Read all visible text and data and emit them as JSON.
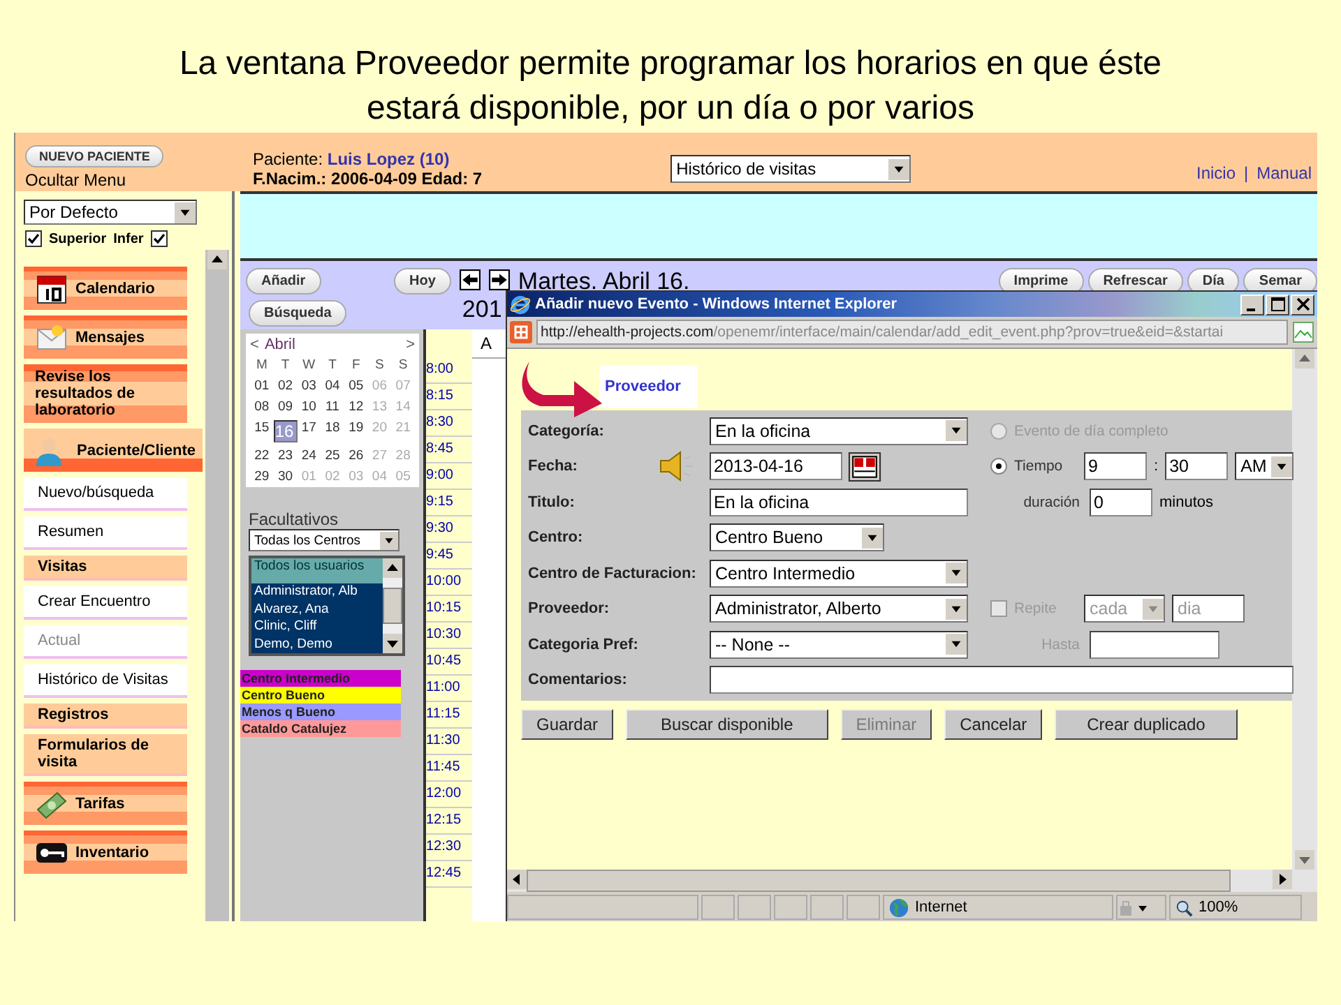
{
  "slide_title": "La ventana Proveedor permite programar los horarios en que éste estará disponible, por un día o por varios",
  "header": {
    "new_patient_button": "NUEVO PACIENTE",
    "hide_menu": "Ocultar Menu",
    "patient_label": "Paciente:",
    "patient_name": "Luis Lopez (10)",
    "birth": "F.Nacim.: 2006-04-09 Edad: 7",
    "view_select": "Histórico de visitas",
    "links": [
      "Inicio",
      "Manual"
    ],
    "link_separator": "|"
  },
  "sidebar": {
    "profile_select": "Por Defecto",
    "checks": [
      {
        "label": "Superior",
        "checked": true
      },
      {
        "label": "Infer",
        "checked": true
      }
    ],
    "items": [
      {
        "kind": "main",
        "label": "Calendario",
        "disabled": false
      },
      {
        "kind": "main",
        "label": "Mensajes",
        "disabled": false
      },
      {
        "kind": "main",
        "label": "Revise los resultados de laboratorio",
        "disabled": false
      },
      {
        "kind": "header",
        "label": "Paciente/Cliente",
        "disabled": false
      },
      {
        "kind": "sub",
        "label": "Nuevo/búsqueda",
        "disabled": false
      },
      {
        "kind": "sub",
        "label": "Resumen",
        "disabled": false
      },
      {
        "kind": "section",
        "label": "Visitas",
        "disabled": false
      },
      {
        "kind": "sub",
        "label": "Crear Encuentro",
        "disabled": false
      },
      {
        "kind": "sub",
        "label": "Actual",
        "disabled": true
      },
      {
        "kind": "sub",
        "label": "Histórico de Visitas",
        "disabled": false
      },
      {
        "kind": "section",
        "label": "Registros",
        "disabled": false
      },
      {
        "kind": "section",
        "label": "Formularios de visita",
        "disabled": false
      },
      {
        "kind": "main",
        "label": "Tarifas",
        "disabled": false
      },
      {
        "kind": "main",
        "label": "Inventario",
        "disabled": false
      }
    ]
  },
  "calendar": {
    "add_button": "Añadir",
    "search_button": "Búsqueda",
    "today_button": "Hoy",
    "date_title": "Martes. Abril 16.",
    "year": "201",
    "view_buttons": [
      "Imprime",
      "Refrescar",
      "Día",
      "Semar"
    ],
    "month": "Abril",
    "prev": "<",
    "next": ">",
    "weekdays": [
      "M",
      "T",
      "W",
      "T",
      "F",
      "S",
      "S"
    ],
    "weeks": [
      [
        {
          "d": "01",
          "muted": false,
          "selected": false
        },
        {
          "d": "02",
          "muted": false,
          "selected": false
        },
        {
          "d": "03",
          "muted": false,
          "selected": false
        },
        {
          "d": "04",
          "muted": false,
          "selected": false
        },
        {
          "d": "05",
          "muted": false,
          "selected": false
        },
        {
          "d": "06",
          "muted": true,
          "selected": false
        },
        {
          "d": "07",
          "muted": true,
          "selected": false
        }
      ],
      [
        {
          "d": "08",
          "muted": false,
          "selected": false
        },
        {
          "d": "09",
          "muted": false,
          "selected": false
        },
        {
          "d": "10",
          "muted": false,
          "selected": false
        },
        {
          "d": "11",
          "muted": false,
          "selected": false
        },
        {
          "d": "12",
          "muted": false,
          "selected": false
        },
        {
          "d": "13",
          "muted": true,
          "selected": false
        },
        {
          "d": "14",
          "muted": true,
          "selected": false
        }
      ],
      [
        {
          "d": "15",
          "muted": false,
          "selected": false
        },
        {
          "d": "16",
          "muted": false,
          "selected": true
        },
        {
          "d": "17",
          "muted": false,
          "selected": false
        },
        {
          "d": "18",
          "muted": false,
          "selected": false
        },
        {
          "d": "19",
          "muted": false,
          "selected": false
        },
        {
          "d": "20",
          "muted": true,
          "selected": false
        },
        {
          "d": "21",
          "muted": true,
          "selected": false
        }
      ],
      [
        {
          "d": "22",
          "muted": false,
          "selected": false
        },
        {
          "d": "23",
          "muted": false,
          "selected": false
        },
        {
          "d": "24",
          "muted": false,
          "selected": false
        },
        {
          "d": "25",
          "muted": false,
          "selected": false
        },
        {
          "d": "26",
          "muted": false,
          "selected": false
        },
        {
          "d": "27",
          "muted": true,
          "selected": false
        },
        {
          "d": "28",
          "muted": true,
          "selected": false
        }
      ],
      [
        {
          "d": "29",
          "muted": false,
          "selected": false
        },
        {
          "d": "30",
          "muted": false,
          "selected": false
        },
        {
          "d": "01",
          "muted": true,
          "selected": false
        },
        {
          "d": "02",
          "muted": true,
          "selected": false
        },
        {
          "d": "03",
          "muted": true,
          "selected": false
        },
        {
          "d": "04",
          "muted": true,
          "selected": false
        },
        {
          "d": "05",
          "muted": true,
          "selected": false
        }
      ]
    ],
    "providers_title": "Facultativos",
    "facility_select": "Todas los Centros",
    "providers": [
      {
        "name": "Todos los usuarios",
        "selected": true
      },
      {
        "name": "Administrator, Alb",
        "selected": false
      },
      {
        "name": "Alvarez, Ana",
        "selected": false
      },
      {
        "name": "Clinic, Cliff",
        "selected": false
      },
      {
        "name": "Demo, Demo",
        "selected": false
      }
    ],
    "legend": [
      {
        "name": "Centro Intermedio",
        "color": "#cc00cc"
      },
      {
        "name": "Centro Bueno",
        "color": "#ffff00"
      },
      {
        "name": "Menos q Bueno",
        "color": "#9999ff"
      },
      {
        "name": "Cataldo Catalujez",
        "color": "#ff9999"
      }
    ],
    "times": [
      "8:00",
      "8:15",
      "8:30",
      "8:45",
      "9:00",
      "9:15",
      "9:30",
      "9:45",
      "10:00",
      "10:15",
      "10:30",
      "10:45",
      "11:00",
      "11:15",
      "11:30",
      "11:45",
      "12:00",
      "12:15",
      "12:30",
      "12:45"
    ],
    "day_header": "A"
  },
  "popup": {
    "title": "Añadir nuevo Evento - Windows Internet Explorer",
    "url_host": "http://ehealth-projects.com",
    "url_path": "/openemr/interface/main/calendar/add_edit_event.php?prov=true&eid=&startai",
    "tab": "Proveedor",
    "fields": [
      {
        "kind": "select",
        "label": "Categoría:",
        "value": "En la oficina"
      },
      {
        "kind": "date",
        "label": "Fecha:",
        "value": "2013-04-16"
      },
      {
        "kind": "text",
        "label": "Titulo:",
        "value": "En la oficina"
      },
      {
        "kind": "short_select",
        "label": "Centro:",
        "value": "Centro Bueno"
      },
      {
        "kind": "select",
        "label": "Centro de Facturacion:",
        "value": "Centro Intermedio"
      },
      {
        "kind": "select",
        "label": "Proveedor:",
        "value": "Administrator, Alberto"
      },
      {
        "kind": "select",
        "label": "Categoria Pref:",
        "value": "-- None --"
      },
      {
        "kind": "wide_text",
        "label": "Comentarios:"
      }
    ],
    "all_day": {
      "label": "Evento de día completo",
      "selected": false,
      "disabled": true
    },
    "time": {
      "label": "Tiempo",
      "selected": true,
      "hour": "9",
      "separator": ":",
      "minute": "30",
      "ampm": "AM"
    },
    "duration": {
      "label": "duración",
      "value": "0",
      "unit": "minutos"
    },
    "repeat": {
      "label": "Repite",
      "checked": false,
      "disabled": true,
      "every": "cada",
      "unit": "dia"
    },
    "until": {
      "label": "Hasta",
      "disabled": true
    },
    "buttons": [
      {
        "label": "Guardar",
        "disabled": false
      },
      {
        "label": "Buscar disponible",
        "disabled": false
      },
      {
        "label": "Eliminar",
        "disabled": true
      },
      {
        "label": "Cancelar",
        "disabled": false
      },
      {
        "label": "Crear duplicado",
        "disabled": false
      }
    ],
    "status": "Internet",
    "zoom": "100%"
  }
}
